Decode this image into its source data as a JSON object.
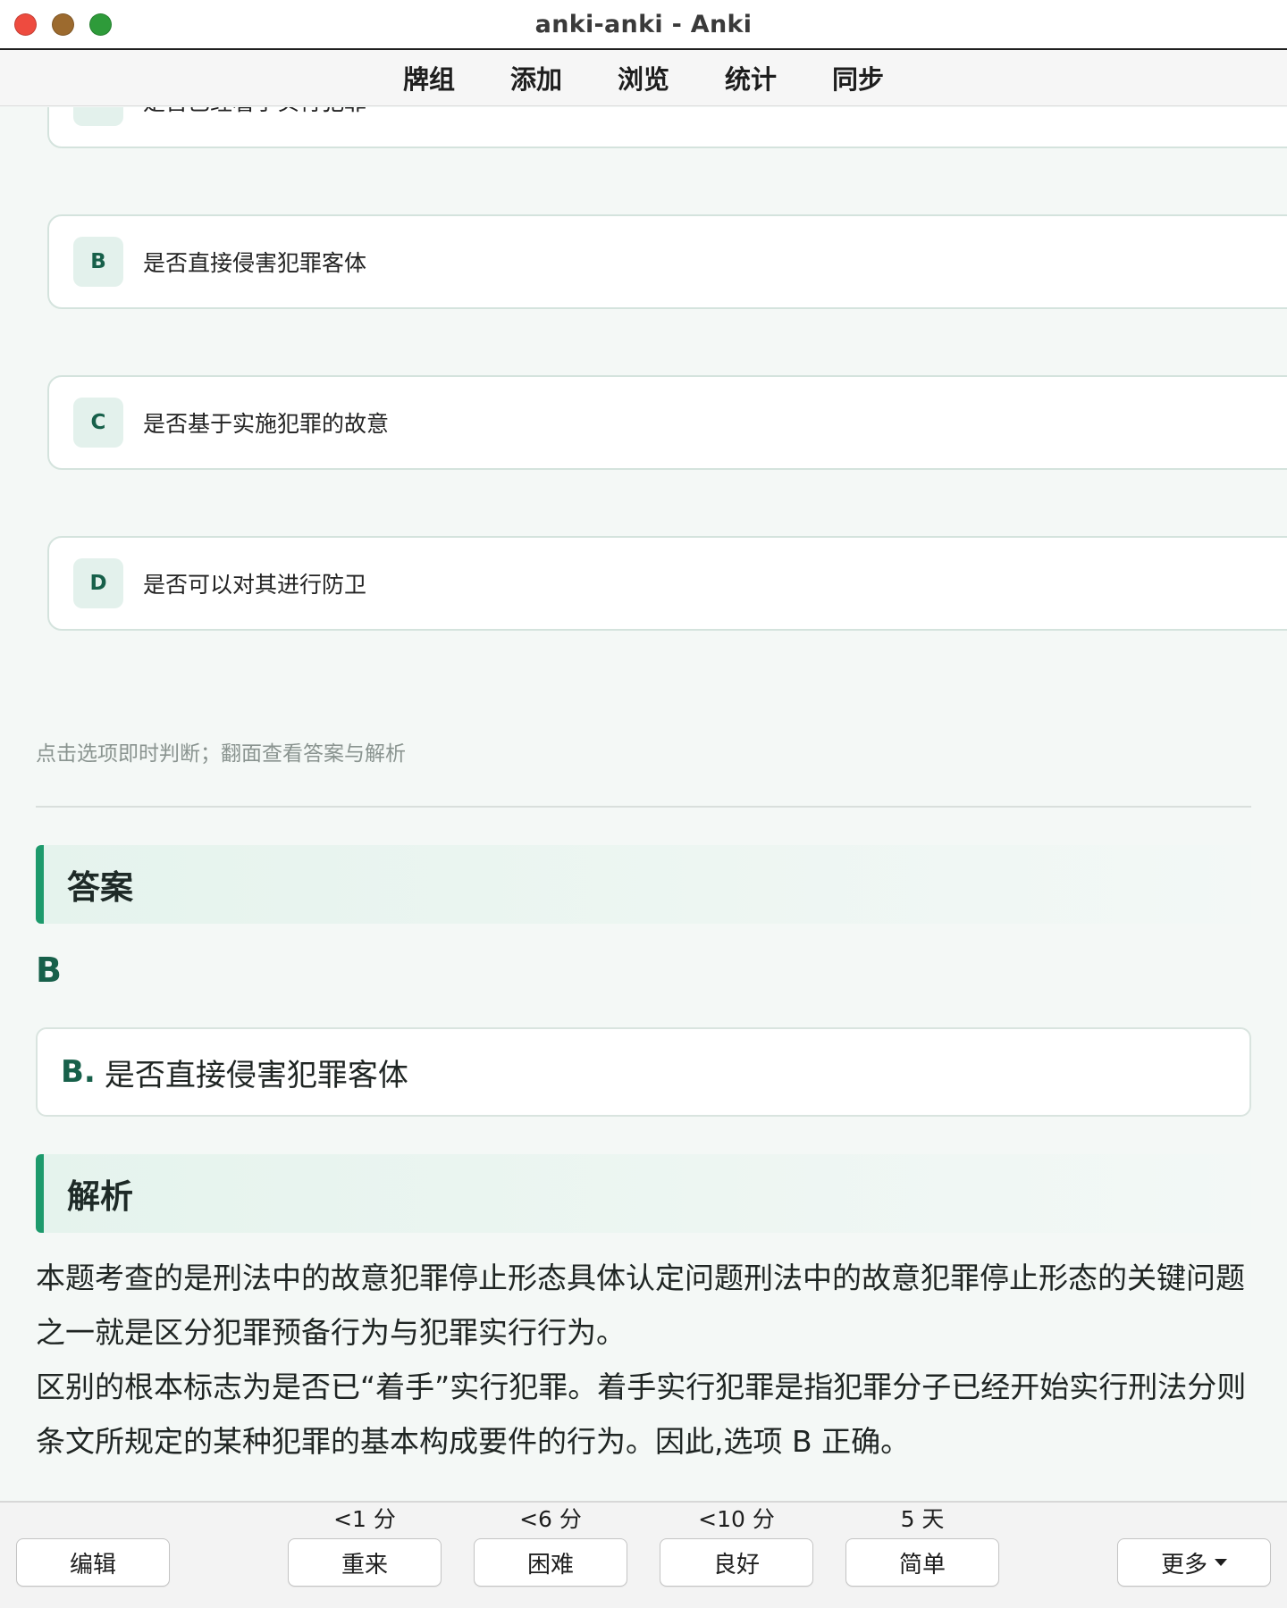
{
  "window": {
    "title": "anki-anki - Anki"
  },
  "topnav": {
    "items": [
      "牌组",
      "添加",
      "浏览",
      "统计",
      "同步"
    ]
  },
  "question": {
    "options": [
      {
        "letter": "A",
        "text": "是否已经着手实行犯罪"
      },
      {
        "letter": "B",
        "text": "是否直接侵害犯罪客体"
      },
      {
        "letter": "C",
        "text": "是否基于实施犯罪的故意"
      },
      {
        "letter": "D",
        "text": "是否可以对其进行防卫"
      }
    ],
    "hint": "点击选项即时判断；翻面查看答案与解析"
  },
  "answer": {
    "heading": "答案",
    "letter": "B",
    "box_prefix": "B.",
    "box_text": "是否直接侵害犯罪客体"
  },
  "analysis": {
    "heading": "解析",
    "paragraph1": "本题考查的是刑法中的故意犯罪停止形态具体认定问题刑法中的故意犯罪停止形态的关键问题之一就是区分犯罪预备行为与犯罪实行行为。",
    "paragraph2": "区别的根本标志为是否已“着手”实行犯罪。着手实行犯罪是指犯罪分子已经开始实行刑法分则条文所规定的某种犯罪的基本构成要件的行为。因此,选项 B 正确。"
  },
  "bottombar": {
    "edit_label": "编辑",
    "more_label": "更多",
    "again": {
      "label": "重来",
      "interval": "<1 分"
    },
    "hard": {
      "label": "困难",
      "interval": "<6 分"
    },
    "good": {
      "label": "良好",
      "interval": "<10 分"
    },
    "easy": {
      "label": "简单",
      "interval": "5 天"
    }
  }
}
